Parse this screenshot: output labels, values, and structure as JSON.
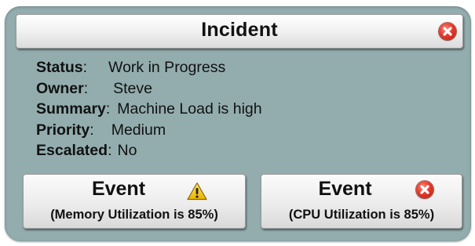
{
  "incident": {
    "title": "Incident",
    "close_icon": "close-icon",
    "details": [
      {
        "label": "Status",
        "value": "Work in Progress"
      },
      {
        "label": "Owner",
        "value": "Steve"
      },
      {
        "label": "Summary",
        "value": "Machine Load is high"
      },
      {
        "label": "Priority",
        "value": "Medium"
      },
      {
        "label": "Escalated",
        "value": "No"
      }
    ]
  },
  "events": [
    {
      "title": "Event",
      "icon": "warning-icon",
      "description": "(Memory Utilization is 85%)"
    },
    {
      "title": "Event",
      "icon": "close-icon",
      "description": "(CPU Utilization is 85%)"
    }
  ],
  "colors": {
    "panel": "#93adae",
    "error": "#e53a2c",
    "warning": "#f2c200"
  }
}
